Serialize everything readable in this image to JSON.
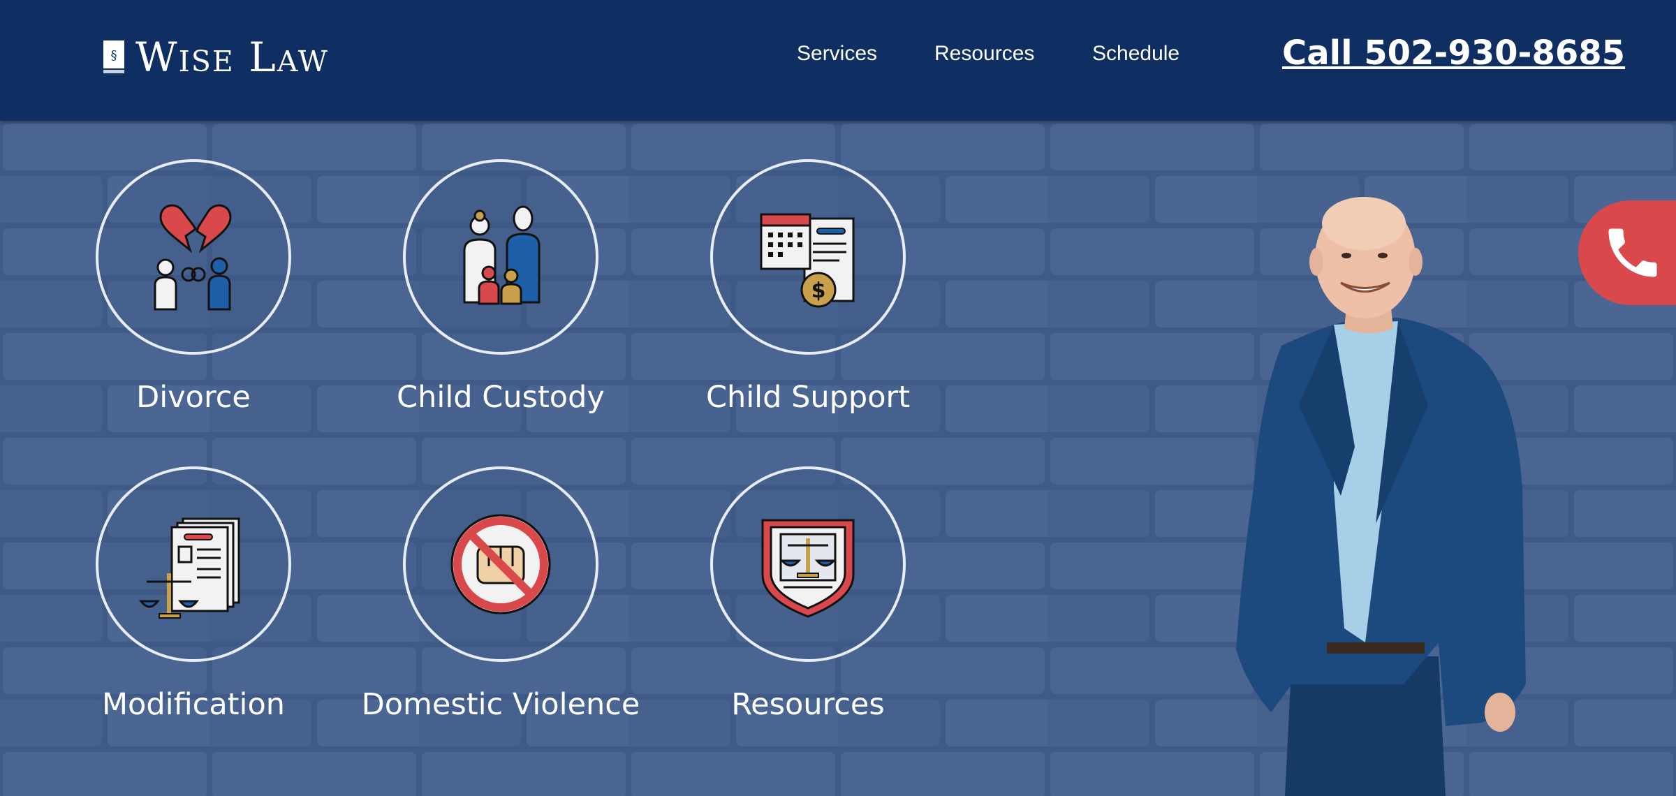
{
  "brand": {
    "name": "Wise Law",
    "book_glyph": "§"
  },
  "nav": {
    "items": [
      {
        "label": "Services"
      },
      {
        "label": "Resources"
      },
      {
        "label": "Schedule"
      }
    ],
    "phone": "Call 502-930-8685"
  },
  "services": [
    {
      "label": "Divorce",
      "icon": "broken-heart-couple-icon"
    },
    {
      "label": "Child Custody",
      "icon": "family-icon"
    },
    {
      "label": "Child Support",
      "icon": "calendar-invoice-coin-icon"
    },
    {
      "label": "Modification",
      "icon": "legal-documents-scales-icon"
    },
    {
      "label": "Domestic Violence",
      "icon": "no-violence-fist-icon"
    },
    {
      "label": "Resources",
      "icon": "scales-shield-icon"
    }
  ],
  "call_button": {
    "icon": "phone-icon"
  },
  "colors": {
    "header_bg": "#0f2f63",
    "wall_bg": "#3f5a87",
    "accent_red": "#d9494c",
    "icon_blue": "#1d5fa8",
    "icon_gold": "#c9a14a"
  }
}
